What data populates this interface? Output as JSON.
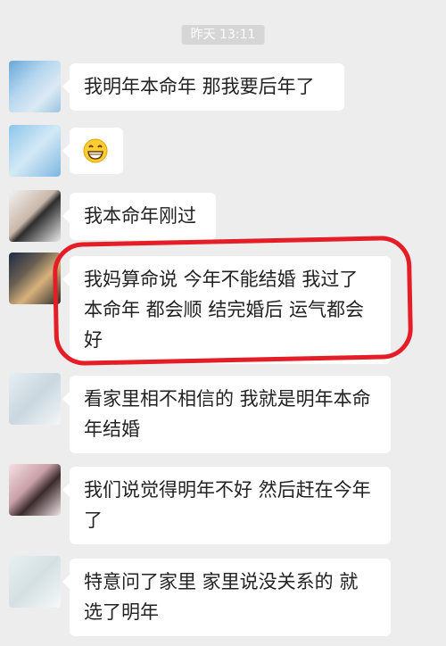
{
  "timestamp": "昨天 13:11",
  "messages": [
    {
      "text": "我明年本命年  那我要后年了"
    },
    {
      "icon": "grinning-face-emoji"
    },
    {
      "text": "我本命年刚过"
    },
    {
      "lines": [
        "我妈算命说 今年不能结婚 我过了",
        "本命年 都会顺 结完婚后 运气都会",
        "好"
      ]
    },
    {
      "lines": [
        "看家里相不相信的 我就是明年本命",
        "年结婚"
      ]
    },
    {
      "lines": [
        "我们说觉得明年不好 然后赶在今年",
        "了"
      ]
    },
    {
      "lines": [
        "特意问了家里 家里说没关系的 就",
        "选了明年"
      ]
    }
  ],
  "colors": {
    "highlight": "#e51d26",
    "background": "#ededed",
    "bubble": "#ffffff"
  }
}
